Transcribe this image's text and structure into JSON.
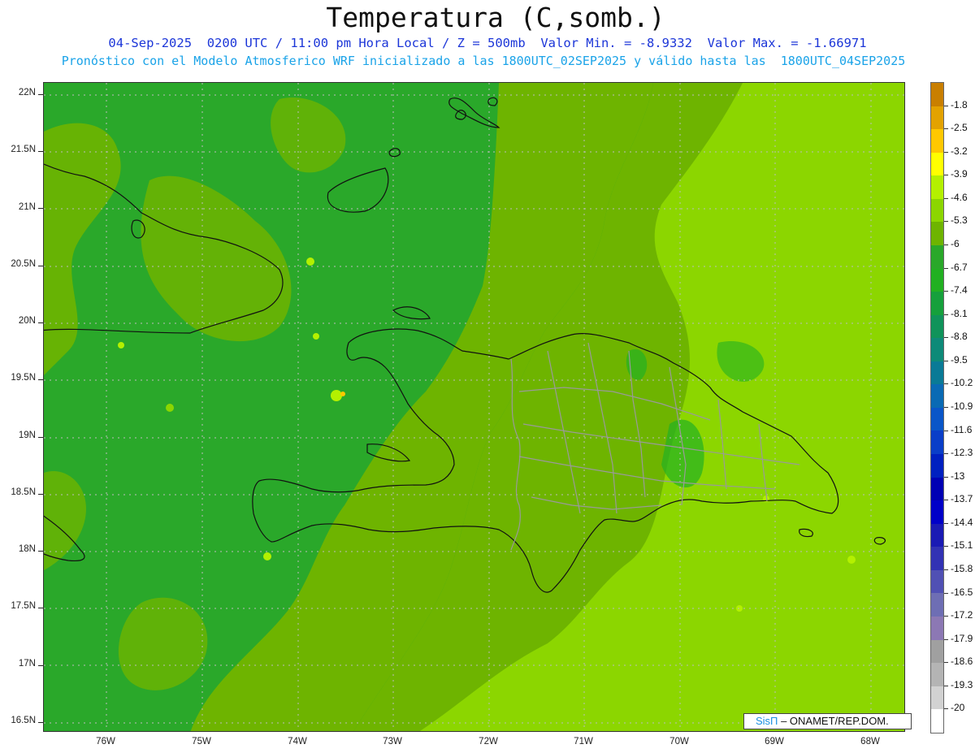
{
  "header": {
    "title": "Temperatura (C,somb.)",
    "line1": "04-Sep-2025  0200 UTC / 11:00 pm Hora Local / Z = 500mb  Valor Min. = -8.9332  Valor Max. = -1.66971",
    "line2": "Pronóstico con el Modelo Atmosferico WRF inicializado a las 1800UTC_02SEP2025 y válido hasta las  1800UTC_04SEP2025"
  },
  "axes": {
    "lat_labels": [
      "22N",
      "21.5N",
      "21N",
      "20.5N",
      "20N",
      "19.5N",
      "19N",
      "18.5N",
      "18N",
      "17.5N",
      "17N",
      "16.5N"
    ],
    "lon_labels": [
      "76W",
      "75W",
      "74W",
      "73W",
      "72W",
      "71W",
      "70W",
      "69W",
      "68W"
    ],
    "lat_range": [
      16.45,
      22.1
    ],
    "lon_range": [
      -76.65,
      -67.65
    ]
  },
  "legend": {
    "labels": [
      "-1.8",
      "-2.5",
      "-3.2",
      "-3.9",
      "-4.6",
      "-5.3",
      "-6",
      "-6.7",
      "-7.4",
      "-8.1",
      "-8.8",
      "-9.5",
      "-10.2",
      "-10.9",
      "-11.6",
      "-12.3",
      "-13",
      "-13.7",
      "-14.4",
      "-15.1",
      "-15.8",
      "-16.5",
      "-17.2",
      "-17.9",
      "-18.6",
      "-19.3",
      "-20"
    ],
    "colors": [
      "#c97f00",
      "#e3a200",
      "#ffc800",
      "#ffff00",
      "#b4f000",
      "#8cd600",
      "#6eb400",
      "#2aa82a",
      "#22b022",
      "#16a03c",
      "#10935a",
      "#0e8a78",
      "#0a7a96",
      "#0a6ab4",
      "#0a56c8",
      "#0a3ec8",
      "#0020c0",
      "#0000b4",
      "#0000c8",
      "#1a1ab4",
      "#3232b4",
      "#5050b4",
      "#6e6eb4",
      "#8c78b4",
      "#a0a0a0",
      "#b4b4b4",
      "#d2d2d2",
      "#ffffff"
    ]
  },
  "map": {
    "background_color": "#2aa82a",
    "zones": [
      {
        "name": "west-dark-green",
        "color": "#2aa82a"
      },
      {
        "name": "mid-green",
        "color": "#6eb400"
      },
      {
        "name": "east-light-green",
        "color": "#8cd600"
      }
    ]
  },
  "credit": {
    "logo": "SisΠ",
    "text": "– ONAMET/REP.DOM."
  }
}
